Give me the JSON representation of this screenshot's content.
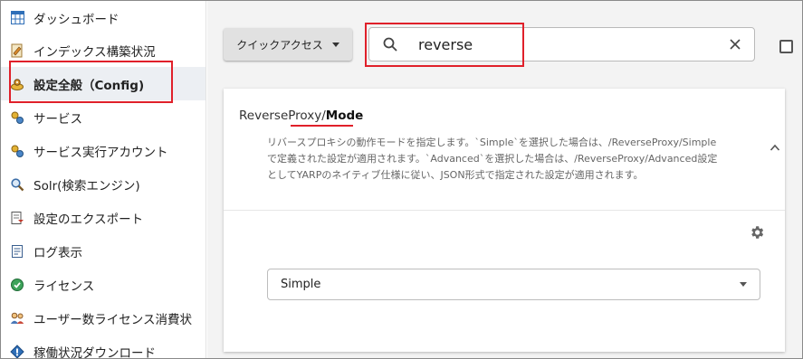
{
  "sidebar": {
    "items": [
      {
        "label": "ダッシュボード",
        "icon": "dashboard-grid-icon"
      },
      {
        "label": "インデックス構築状況",
        "icon": "index-build-icon"
      },
      {
        "label": "設定全般（Config)",
        "icon": "config-icon",
        "active": true
      },
      {
        "label": "サービス",
        "icon": "service-icon"
      },
      {
        "label": "サービス実行アカウント",
        "icon": "service-account-icon"
      },
      {
        "label": "Solr(検索エンジン)",
        "icon": "search-engine-icon"
      },
      {
        "label": "設定のエクスポート",
        "icon": "export-icon"
      },
      {
        "label": "ログ表示",
        "icon": "log-icon"
      },
      {
        "label": "ライセンス",
        "icon": "license-icon"
      },
      {
        "label": "ユーザー数ライセンス消費状",
        "icon": "user-license-icon"
      },
      {
        "label": "稼働状況ダウンロード",
        "icon": "download-icon"
      }
    ]
  },
  "toolbar": {
    "quick_access_label": "クイックアクセス",
    "search_value": "reverse"
  },
  "setting": {
    "title_prefix": "ReverseProxy/",
    "title_key": "Mode",
    "description_lines": [
      "リバースプロキシの動作モードを指定します。`Simple`を選択した場合は、/ReverseProxy/Simple",
      "で定義された設定が適用されます。`Advanced`を選択した場合は、/ReverseProxy/Advanced設定",
      "としてYARPのネイティブ仕様に従い、JSON形式で指定された設定が適用されます。"
    ],
    "selected_value": "Simple"
  },
  "colors": {
    "highlight": "#e0202a",
    "active_bg": "#eceff3",
    "main_bg": "#f3f3f3"
  }
}
